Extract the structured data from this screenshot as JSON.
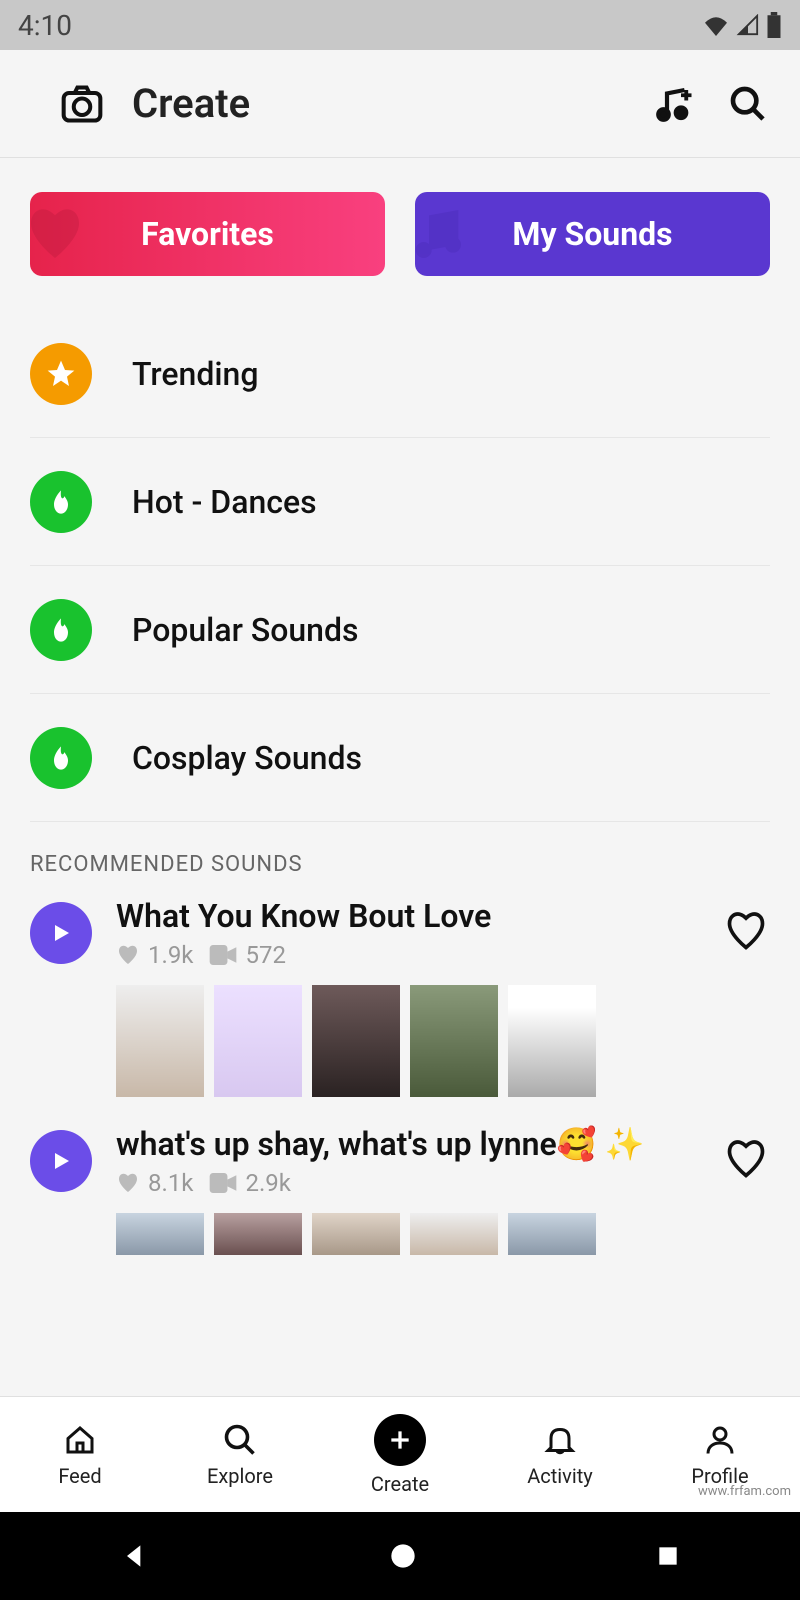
{
  "status": {
    "time": "4:10"
  },
  "header": {
    "title": "Create"
  },
  "tabs": {
    "favorites": "Favorites",
    "mysounds": "My Sounds"
  },
  "categories": [
    {
      "label": "Trending",
      "color": "orange",
      "icon": "star"
    },
    {
      "label": "Hot - Dances",
      "color": "green",
      "icon": "flame"
    },
    {
      "label": "Popular Sounds",
      "color": "green",
      "icon": "flame"
    },
    {
      "label": "Cosplay Sounds",
      "color": "green",
      "icon": "flame"
    }
  ],
  "section_title": "RECOMMENDED SOUNDS",
  "sounds": [
    {
      "title": "What You Know Bout Love",
      "likes": "1.9k",
      "videos": "572"
    },
    {
      "title": "what's up shay, what's up lynne🥰 ✨",
      "likes": "8.1k",
      "videos": "2.9k"
    }
  ],
  "nav": {
    "feed": "Feed",
    "explore": "Explore",
    "create": "Create",
    "activity": "Activity",
    "profile": "Profile"
  },
  "watermark": "www.frfam.com"
}
